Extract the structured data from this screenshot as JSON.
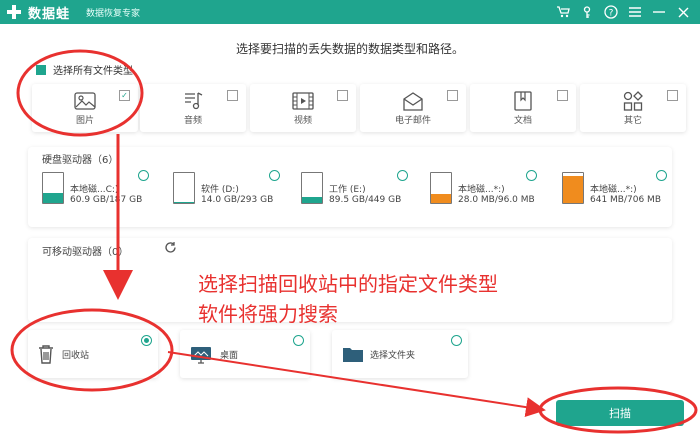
{
  "titlebar": {
    "app_name": "数据蛙",
    "subtitle": "数据恢复专家",
    "icons": [
      "cart-icon",
      "key-icon",
      "help-icon",
      "menu-icon",
      "minimize-icon",
      "close-icon"
    ]
  },
  "heading": "选择要扫描的丢失数据的数据类型和路径。",
  "select_all_label": "选择所有文件类型",
  "file_types": [
    {
      "label": "图片",
      "icon": "image-icon",
      "checked": true
    },
    {
      "label": "音频",
      "icon": "audio-icon",
      "checked": false
    },
    {
      "label": "视频",
      "icon": "video-icon",
      "checked": false
    },
    {
      "label": "电子邮件",
      "icon": "email-icon",
      "checked": false
    },
    {
      "label": "文档",
      "icon": "document-icon",
      "checked": false
    },
    {
      "label": "其它",
      "icon": "other-icon",
      "checked": false
    }
  ],
  "hard_drives": {
    "title": "硬盘驱动器（6）",
    "drives": [
      {
        "name": "本地磁...C:)",
        "size": "60.9 GB/187 GB",
        "used": 0.33
      },
      {
        "name": "软件 (D:)",
        "size": "14.0 GB/293 GB",
        "used": 0.05
      },
      {
        "name": "工作 (E:)",
        "size": "89.5 GB/449 GB",
        "used": 0.2
      },
      {
        "name": "本地磁...*:)",
        "size": "28.0 MB/96.0 MB",
        "used": 0.29
      },
      {
        "name": "本地磁...*:)",
        "size": "641 MB/706 MB",
        "used": 0.91
      }
    ]
  },
  "removable": {
    "title": "可移动驱动器（0）"
  },
  "locations": [
    {
      "label": "回收站",
      "icon": "recycle-bin-icon",
      "selected": true
    },
    {
      "label": "桌面",
      "icon": "desktop-icon",
      "selected": false
    },
    {
      "label": "选择文件夹",
      "icon": "folder-icon",
      "selected": false
    }
  ],
  "annotation": {
    "line1": "选择扫描回收站中的指定文件类型",
    "line2": "软件将强力搜索"
  },
  "scan_button": "扫描",
  "colors": {
    "accent": "#1fa58e",
    "annotation": "#e8312f",
    "drive_orange": "#f08c1e"
  }
}
